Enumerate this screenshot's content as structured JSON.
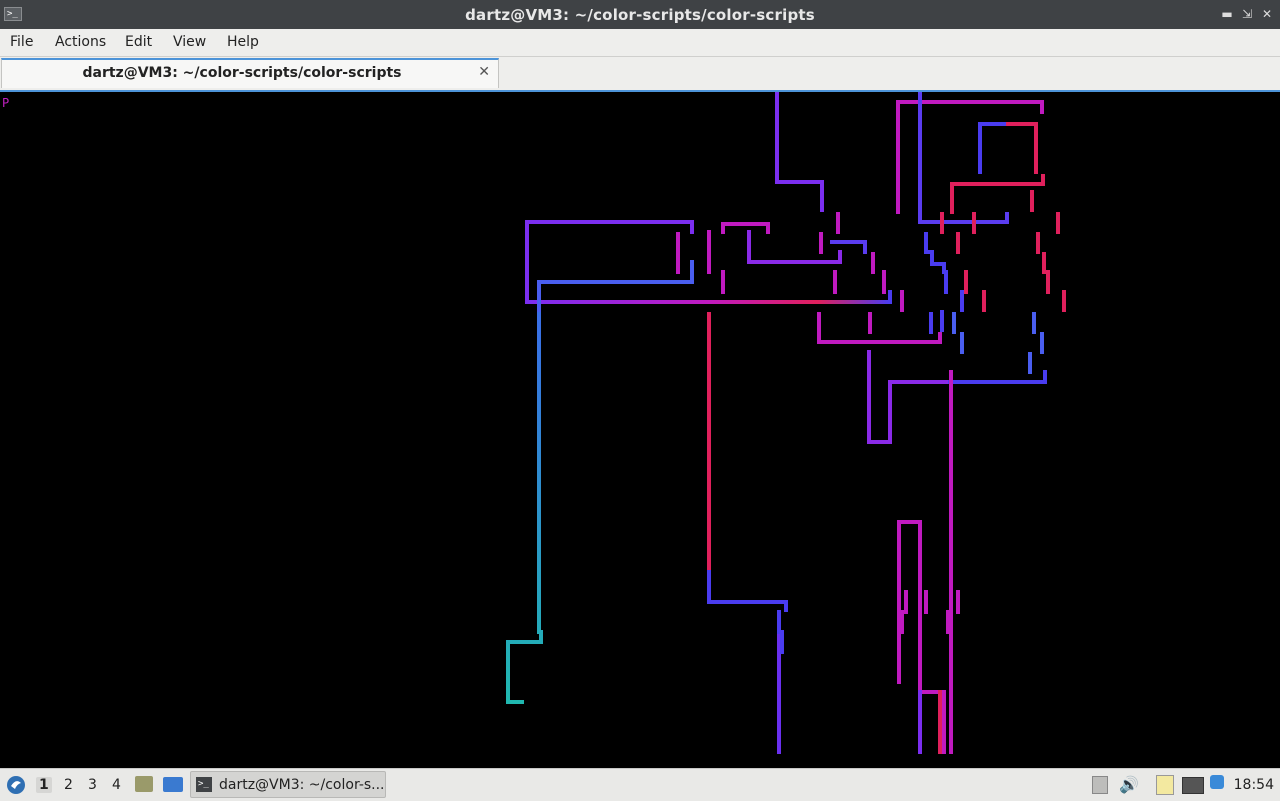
{
  "window": {
    "title": "dartz@VM3: ~/color-scripts/color-scripts",
    "app_icon": "terminal-icon"
  },
  "menu": [
    "File",
    "Actions",
    "Edit",
    "View",
    "Help"
  ],
  "tabs": [
    {
      "label": "dartz@VM3: ~/color-scripts/color-scripts",
      "active": true
    }
  ],
  "terminal": {
    "prompt_char": "P",
    "background": "#000000",
    "pipe_palette": [
      "#7b2ef0",
      "#4a3cf0",
      "#c01ac0",
      "#e0205c",
      "#3a6ee8",
      "#20b8b0"
    ]
  },
  "taskbar": {
    "desktops": [
      "1",
      "2",
      "3",
      "4"
    ],
    "active_desktop": "1",
    "task_label": "dartz@VM3: ~/color-s...",
    "clock": "18:54"
  },
  "colors": {
    "titlebar": "#3f4245",
    "accent": "#4c93d8",
    "panel": "#e9e9e7"
  }
}
